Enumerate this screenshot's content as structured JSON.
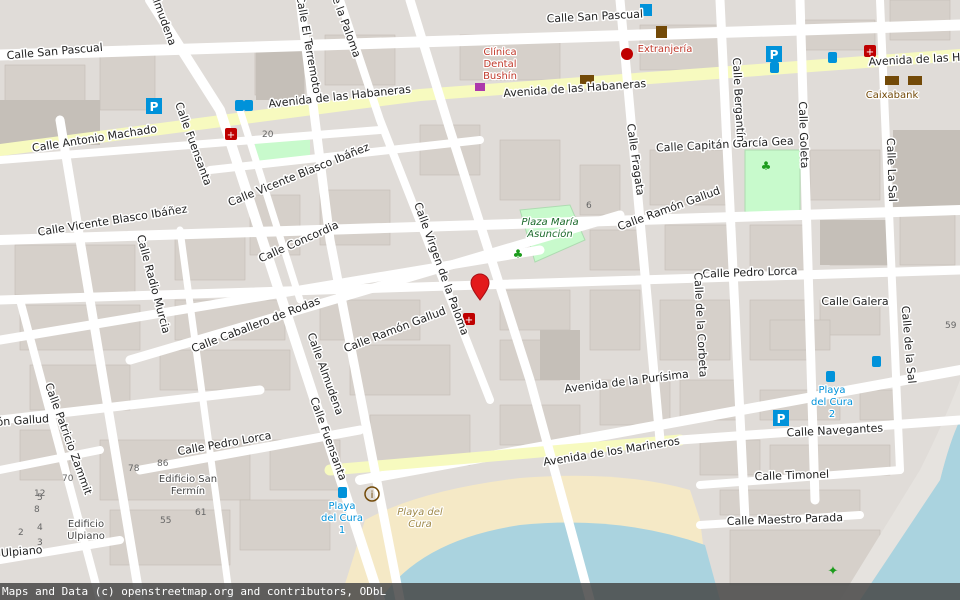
{
  "attribution": "Maps and Data (c) openstreetmap.org and contributors, ODbL",
  "colors": {
    "land": "#e0dcd8",
    "road": "#ffffff",
    "primary": "#f7fabf",
    "park": "#c8facc",
    "sand": "#f5e9c6",
    "sea": "#aad3df",
    "pin": "#e31a1c"
  },
  "streets": [
    {
      "id": "san-pascual-w",
      "text": "Calle San Pascual"
    },
    {
      "id": "san-pascual-e",
      "text": "Calle San Pascual"
    },
    {
      "id": "habaneras-w",
      "text": "Avenida de las Habaneras"
    },
    {
      "id": "habaneras-e",
      "text": "Avenida de las Habaneras"
    },
    {
      "id": "habaneras-far",
      "text": "Avenida de las Ha"
    },
    {
      "id": "antonio-machado",
      "text": "Calle Antonio Machado"
    },
    {
      "id": "vicente-blasco-1",
      "text": "Calle Vicente Blasco Ibáñez"
    },
    {
      "id": "vicente-blasco-2",
      "text": "Calle Vicente Blasco Ibáñez"
    },
    {
      "id": "concordia",
      "text": "Calle Concordia"
    },
    {
      "id": "caballero-rodas",
      "text": "Calle Caballero de Rodas"
    },
    {
      "id": "ramon-gallud-c",
      "text": "Calle Ramón Gallud"
    },
    {
      "id": "ramon-gallud-e",
      "text": "Calle Ramón Gallud"
    },
    {
      "id": "ramon-gallud-w",
      "text": "ón Gallud"
    },
    {
      "id": "pedro-lorca-w",
      "text": "Calle Pedro Lorca"
    },
    {
      "id": "pedro-lorca-e",
      "text": "Calle Pedro Lorca"
    },
    {
      "id": "purisima",
      "text": "Avenida de la Purísima"
    },
    {
      "id": "marineros",
      "text": "Avenida de los Marineros"
    },
    {
      "id": "capitan-garcia",
      "text": "Calle Capitán García Gea"
    },
    {
      "id": "galera",
      "text": "Calle Galera"
    },
    {
      "id": "navegantes",
      "text": "Calle Navegantes"
    },
    {
      "id": "timonel",
      "text": "Calle Timonel"
    },
    {
      "id": "maestro-parada",
      "text": "Calle Maestro Parada"
    },
    {
      "id": "ulpiano",
      "text": "Ulpiano"
    },
    {
      "id": "almudena-top",
      "text": "Almudena"
    },
    {
      "id": "almudena",
      "text": "Calle Almudena"
    },
    {
      "id": "terremoto",
      "text": "Calle El Terremoto"
    },
    {
      "id": "de-la-paloma-top",
      "text": "de la Paloma"
    },
    {
      "id": "fuensanta-n",
      "text": "Calle Fuensanta"
    },
    {
      "id": "fuensanta-s",
      "text": "Calle Fuensanta"
    },
    {
      "id": "radio-murcia",
      "text": "Calle Radio Murcia"
    },
    {
      "id": "patricio-zammit",
      "text": "Calle Patricio Zammit"
    },
    {
      "id": "virgen-paloma",
      "text": "Calle Virgen de la Paloma"
    },
    {
      "id": "fragata",
      "text": "Calle Fragata"
    },
    {
      "id": "bergantin",
      "text": "Calle Bergantín"
    },
    {
      "id": "goleta",
      "text": "Calle Goleta"
    },
    {
      "id": "la-sal",
      "text": "Calle La Sal"
    },
    {
      "id": "corbeta",
      "text": "Calle de la Corbeta"
    },
    {
      "id": "de-la-sal-s",
      "text": "Calle de la Sal"
    }
  ],
  "pois": [
    {
      "id": "clinica",
      "text": "Clínica Dental Bushín"
    },
    {
      "id": "extranjeria",
      "text": "Extranjería"
    },
    {
      "id": "caixabank",
      "text": "Caixabank"
    },
    {
      "id": "plaza-maria",
      "text": "Plaza María Asunción"
    },
    {
      "id": "playa-del-cura-2",
      "text": "Playa del Cura 2"
    },
    {
      "id": "playa-del-cura-1",
      "text": "Playa del Cura 1"
    },
    {
      "id": "playa-del-cura",
      "text": "Playa del Cura"
    },
    {
      "id": "edificio-san-fermin",
      "text": "Edificio San Fermín"
    },
    {
      "id": "edificio-ulpiano",
      "text": "Edificio Ulpiano"
    }
  ],
  "house_numbers": [
    "20",
    "6",
    "59",
    "78",
    "86",
    "55",
    "61",
    "70",
    "12",
    "8",
    "4",
    "5",
    "3",
    "2"
  ],
  "icons": [
    "marker-pin",
    "pharmacy-icon",
    "parking-icon",
    "bus-stop-icon",
    "bank-icon",
    "police-icon",
    "veterinary-icon",
    "tourism-info-icon",
    "park-icon",
    "shop-icon",
    "fitness-icon"
  ]
}
